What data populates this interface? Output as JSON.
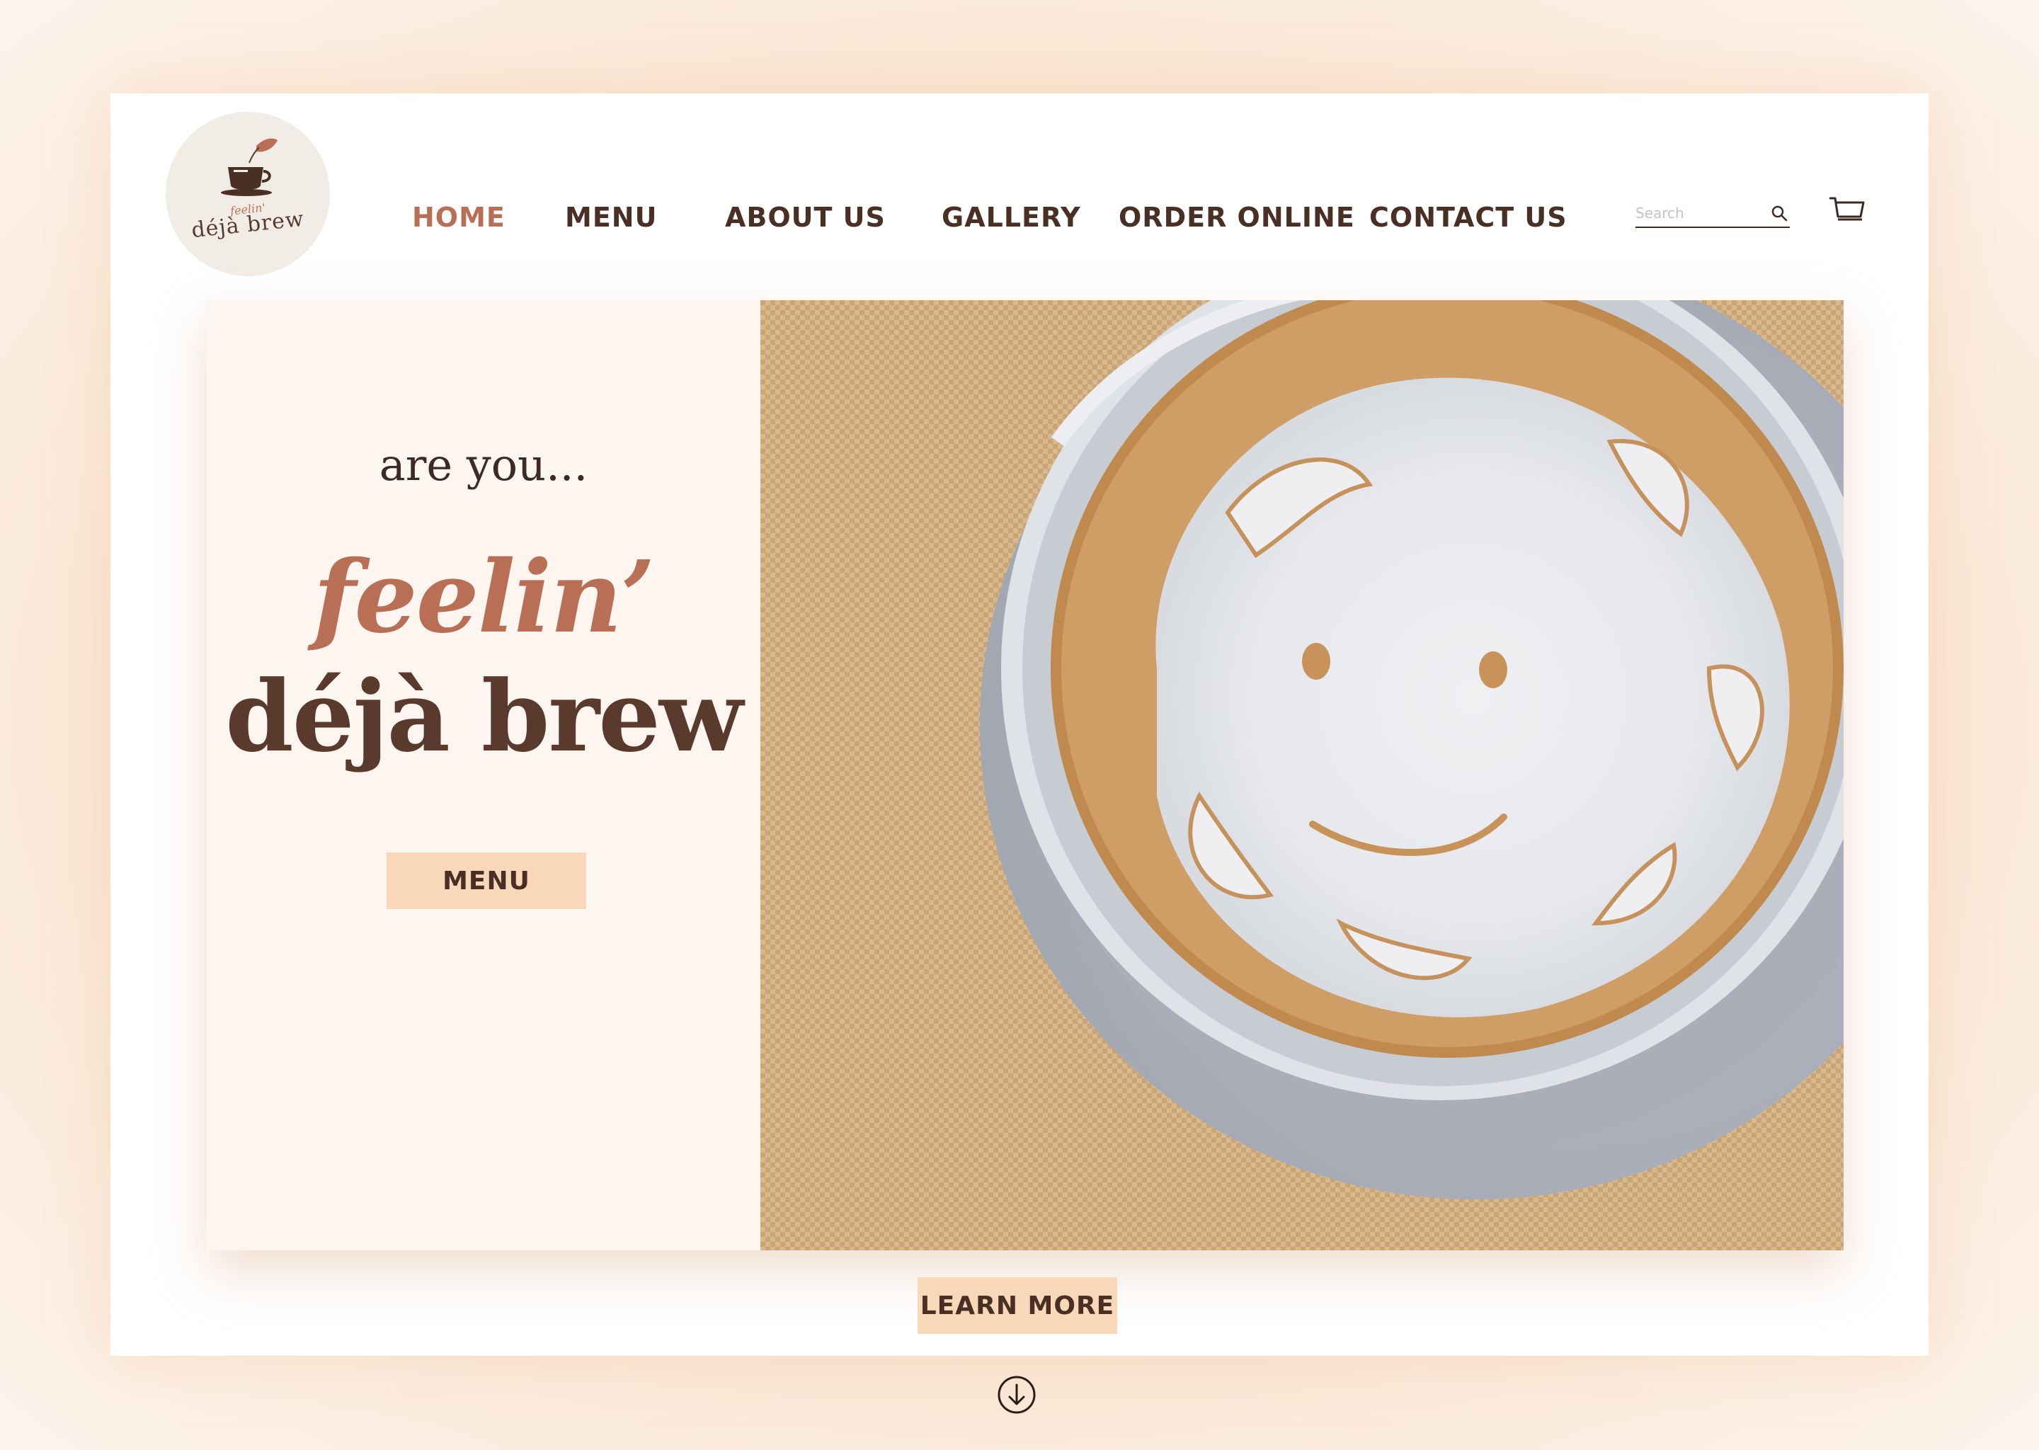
{
  "brand": {
    "logo_small": "feelin'",
    "logo_name": "déjà brew",
    "logo_icon": "coffee-cup-leaf-icon"
  },
  "nav": {
    "items": [
      {
        "label": "HOME",
        "active": true
      },
      {
        "label": "MENU",
        "active": false
      },
      {
        "label": "ABOUT US",
        "active": false
      },
      {
        "label": "GALLERY",
        "active": false
      },
      {
        "label": "ORDER ONLINE",
        "active": false
      },
      {
        "label": "CONTACT US",
        "active": false
      }
    ]
  },
  "search": {
    "placeholder": "Search",
    "icon": "search-icon"
  },
  "cart": {
    "icon": "cart-icon"
  },
  "hero": {
    "intro": "are you...",
    "headline_1": "feelin’",
    "headline_2": "déjà brew",
    "menu_button": "MENU",
    "image": "latte-art-smiley-face-photo"
  },
  "learn_more_button": "LEARN MORE",
  "scroll_icon": "arrow-down-circle-icon",
  "colors": {
    "accent": "#b86f55",
    "text_dark": "#4a2f25",
    "heading_brown": "#5b3a2e",
    "button_peach": "#f9d7b9",
    "panel_cream": "#fdf6f0"
  }
}
